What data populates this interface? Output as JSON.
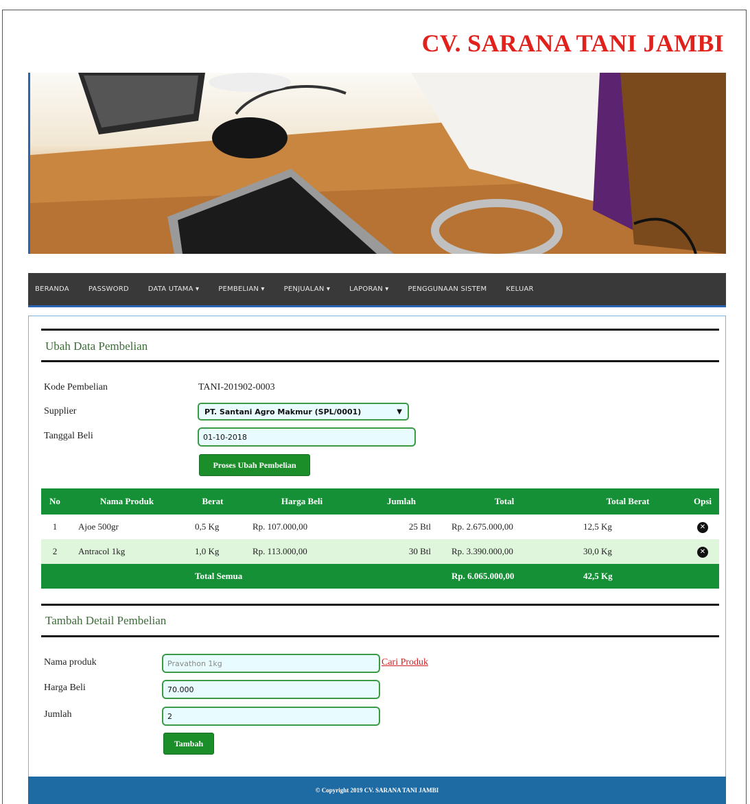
{
  "brand": "CV. SARANA TANI JAMBI",
  "nav": [
    "BERANDA",
    "PASSWORD",
    "DATA UTAMA ▾",
    "PEMBELIAN ▾",
    "PENJUALAN ▾",
    "LAPORAN ▾",
    "PENGGUNAAN SISTEM",
    "KELUAR"
  ],
  "edit_section": {
    "title": "Ubah Data Pembelian",
    "code_label": "Kode Pembelian",
    "code_value": "TANI-201902-0003",
    "supplier_label": "Supplier",
    "supplier_value": "PT. Santani Agro Makmur (SPL/0001)",
    "date_label": "Tanggal Beli",
    "date_value": "01-10-2018",
    "submit_label": "Proses Ubah Pembelian"
  },
  "table": {
    "headers": [
      "No",
      "Nama Produk",
      "Berat",
      "Harga Beli",
      "Jumlah",
      "Total",
      "Total Berat",
      "Opsi"
    ],
    "rows": [
      {
        "no": "1",
        "name": "Ajoe 500gr",
        "weight": "0,5 Kg",
        "price": "Rp. 107.000,00",
        "qty": "25 Btl",
        "total": "Rp. 2.675.000,00",
        "total_weight": "12,5 Kg"
      },
      {
        "no": "2",
        "name": "Antracol 1kg",
        "weight": "1,0 Kg",
        "price": "Rp. 113.000,00",
        "qty": "30 Btl",
        "total": "Rp. 3.390.000,00",
        "total_weight": "30,0 Kg"
      }
    ],
    "total_row": {
      "label": "Total Semua",
      "total": "Rp. 6.065.000,00",
      "total_weight": "42,5 Kg"
    },
    "delete_icon": "x-circle-icon"
  },
  "add_section": {
    "title": "Tambah Detail Pembelian",
    "product_label": "Nama produk",
    "product_value": "Pravathon 1kg",
    "search_link": "Cari Produk",
    "price_label": "Harga Beli",
    "price_value": "70.000",
    "qty_label": "Jumlah",
    "qty_value": "2",
    "add_label": "Tambah"
  },
  "footer": "© Copyright 2019 CV. SARANA TANI JAMBI",
  "colors": {
    "brand": "#e0211c",
    "nav_bg": "#393939",
    "accent_green": "#169036",
    "footer_bg": "#1e6aa2"
  }
}
